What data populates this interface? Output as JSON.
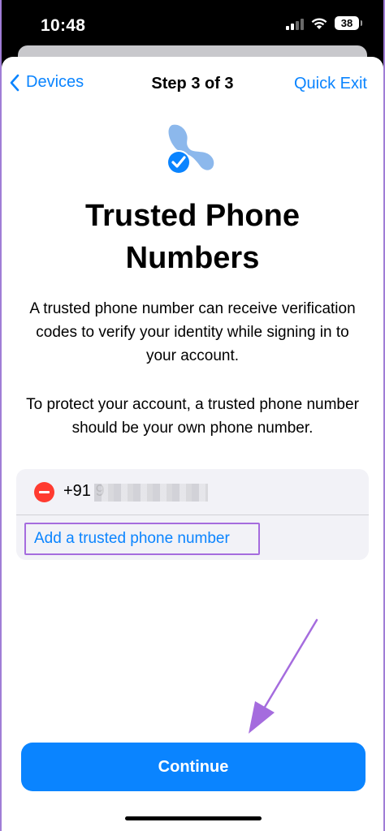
{
  "status_bar": {
    "time": "10:48",
    "battery": "38"
  },
  "nav": {
    "back_label": "Devices",
    "title": "Step 3 of 3",
    "exit_label": "Quick Exit"
  },
  "content": {
    "title": "Trusted Phone Numbers",
    "description_1": "A trusted phone number can receive verification codes to verify your identity while signing in to your account.",
    "description_2": "To protect your account, a trusted phone number should be your own phone number."
  },
  "phone_list": {
    "number_prefix": "+91 9",
    "add_label": "Add a trusted phone number"
  },
  "actions": {
    "continue_label": "Continue"
  },
  "colors": {
    "accent": "#0a84ff",
    "remove": "#ff3b30",
    "highlight": "#a56cde"
  }
}
